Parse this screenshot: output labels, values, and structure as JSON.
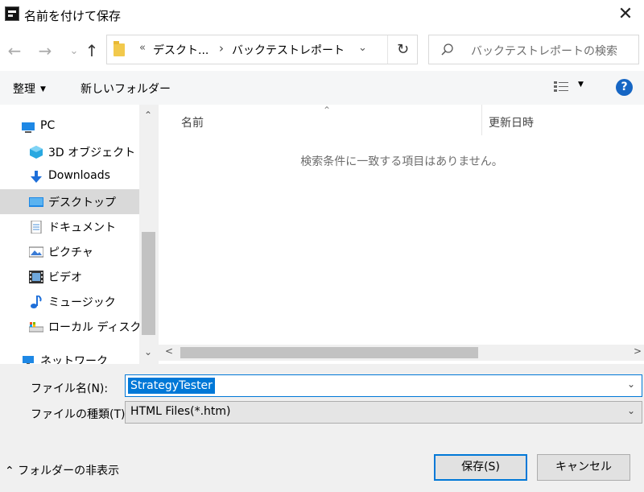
{
  "window": {
    "title": "名前を付けて保存",
    "close_glyph": "✕"
  },
  "nav": {
    "back_glyph": "←",
    "forward_glyph": "→",
    "recent_glyph": "⌄",
    "up_glyph": "↑",
    "breadcrumb_sep_start": "«",
    "breadcrumb": [
      "デスクト...",
      "バックテストレポート"
    ],
    "breadcrumb_sep": "›",
    "address_dropdown_glyph": "⌄",
    "refresh_glyph": "↻",
    "search_placeholder": "バックテストレポートの検索"
  },
  "toolbar": {
    "organize_label": "整理",
    "organize_caret": "▼",
    "new_folder_label": "新しいフォルダー",
    "view_caret": "▼",
    "help_label": "?"
  },
  "sidebar": {
    "items": [
      {
        "label": "PC",
        "icon": "pc-icon"
      },
      {
        "label": "3D オブジェクト",
        "icon": "3d-objects-icon"
      },
      {
        "label": "Downloads",
        "icon": "download-icon"
      },
      {
        "label": "デスクトップ",
        "icon": "desktop-icon",
        "selected": true
      },
      {
        "label": "ドキュメント",
        "icon": "document-icon"
      },
      {
        "label": "ピクチャ",
        "icon": "picture-icon"
      },
      {
        "label": "ビデオ",
        "icon": "video-icon"
      },
      {
        "label": "ミュージック",
        "icon": "music-icon"
      },
      {
        "label": "ローカル ディスク (C",
        "icon": "disk-icon"
      },
      {
        "label": "ネットワーク",
        "icon": "network-icon"
      }
    ],
    "scroll_up_glyph": "⌃",
    "scroll_down_glyph": "⌄"
  },
  "content": {
    "col_name": "名前",
    "col_date": "更新日時",
    "sort_glyph": "⌃",
    "empty_message": "検索条件に一致する項目はありません。",
    "scroll_left_glyph": "<",
    "scroll_right_glyph": ">"
  },
  "save_form": {
    "filename_label": "ファイル名(N):",
    "filename_value": "StrategyTester",
    "filetype_label": "ファイルの種類(T):",
    "filetype_value": "HTML Files(*.htm)",
    "dropdown_glyph": "⌄"
  },
  "footer": {
    "hide_folders_label": "⌃ フォルダーの非表示",
    "save_label": "保存(S)",
    "cancel_label": "キャンセル"
  },
  "colors": {
    "accent": "#0078d7",
    "help": "#1666c4",
    "selected_bg": "#d9d9d9",
    "panel_bg": "#f0f0f0"
  }
}
